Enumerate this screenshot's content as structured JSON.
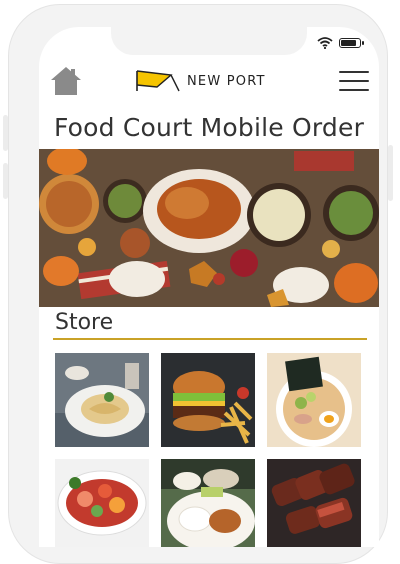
{
  "status_bar": {
    "battery_level": 0.9
  },
  "header": {
    "brand": "NEW PORT",
    "home_icon": "home-icon",
    "menu_icon": "hamburger-menu-icon"
  },
  "page": {
    "title": "Food Court Mobile Order"
  },
  "hero": {
    "image": "autumn-feast-table"
  },
  "store": {
    "heading": "Store",
    "accent_color": "#c9a227",
    "items": [
      {
        "image": "pasta-dish"
      },
      {
        "image": "burger-and-fries"
      },
      {
        "image": "ramen-bowl"
      },
      {
        "image": "poke-bowl"
      },
      {
        "image": "rice-plate"
      },
      {
        "image": "grilled-steak"
      }
    ]
  }
}
